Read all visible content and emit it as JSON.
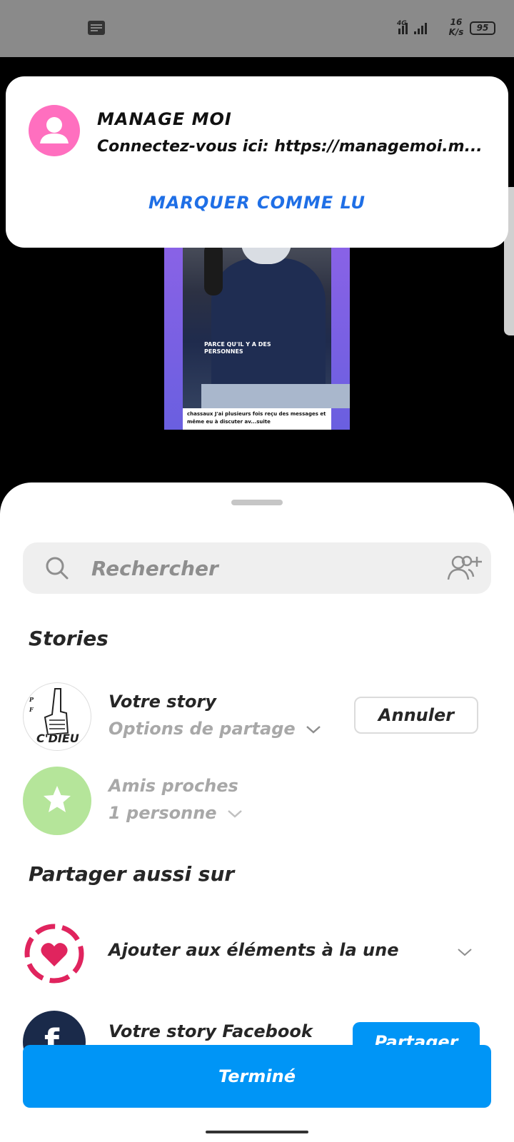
{
  "status_bar": {
    "network": "4G",
    "speed_value": "16",
    "speed_unit": "K/s",
    "battery": "95"
  },
  "story_preview": {
    "overlay_text": "PARCE QU'IL Y A DES PERSONNES",
    "caption": "chassaux J'ai plusieurs fois reçu des messages et même eu à discuter av...suite"
  },
  "notification": {
    "title": "MANAGE MOI",
    "body": "Connectez-vous ici: https://managemoi.m...",
    "action": "MARQUER COMME LU"
  },
  "share_sheet": {
    "search_placeholder": "Rechercher",
    "stories_title": "Stories",
    "your_story": {
      "title": "Votre story",
      "subtitle": "Options de partage",
      "logo_text": "C'DIEU",
      "cancel": "Annuler"
    },
    "close_friends": {
      "title": "Amis proches",
      "subtitle": "1 personne"
    },
    "also_share_title": "Partager aussi sur",
    "highlights": {
      "title": "Ajouter aux éléments à la une"
    },
    "facebook": {
      "title": "Votre story Facebook",
      "share": "Partager"
    },
    "done": "Terminé"
  },
  "colors": {
    "accent_blue": "#0095f6",
    "notif_avatar": "#ff6fbf",
    "close_friends_green": "#b5e59a",
    "highlight_pink": "#e0245e"
  }
}
